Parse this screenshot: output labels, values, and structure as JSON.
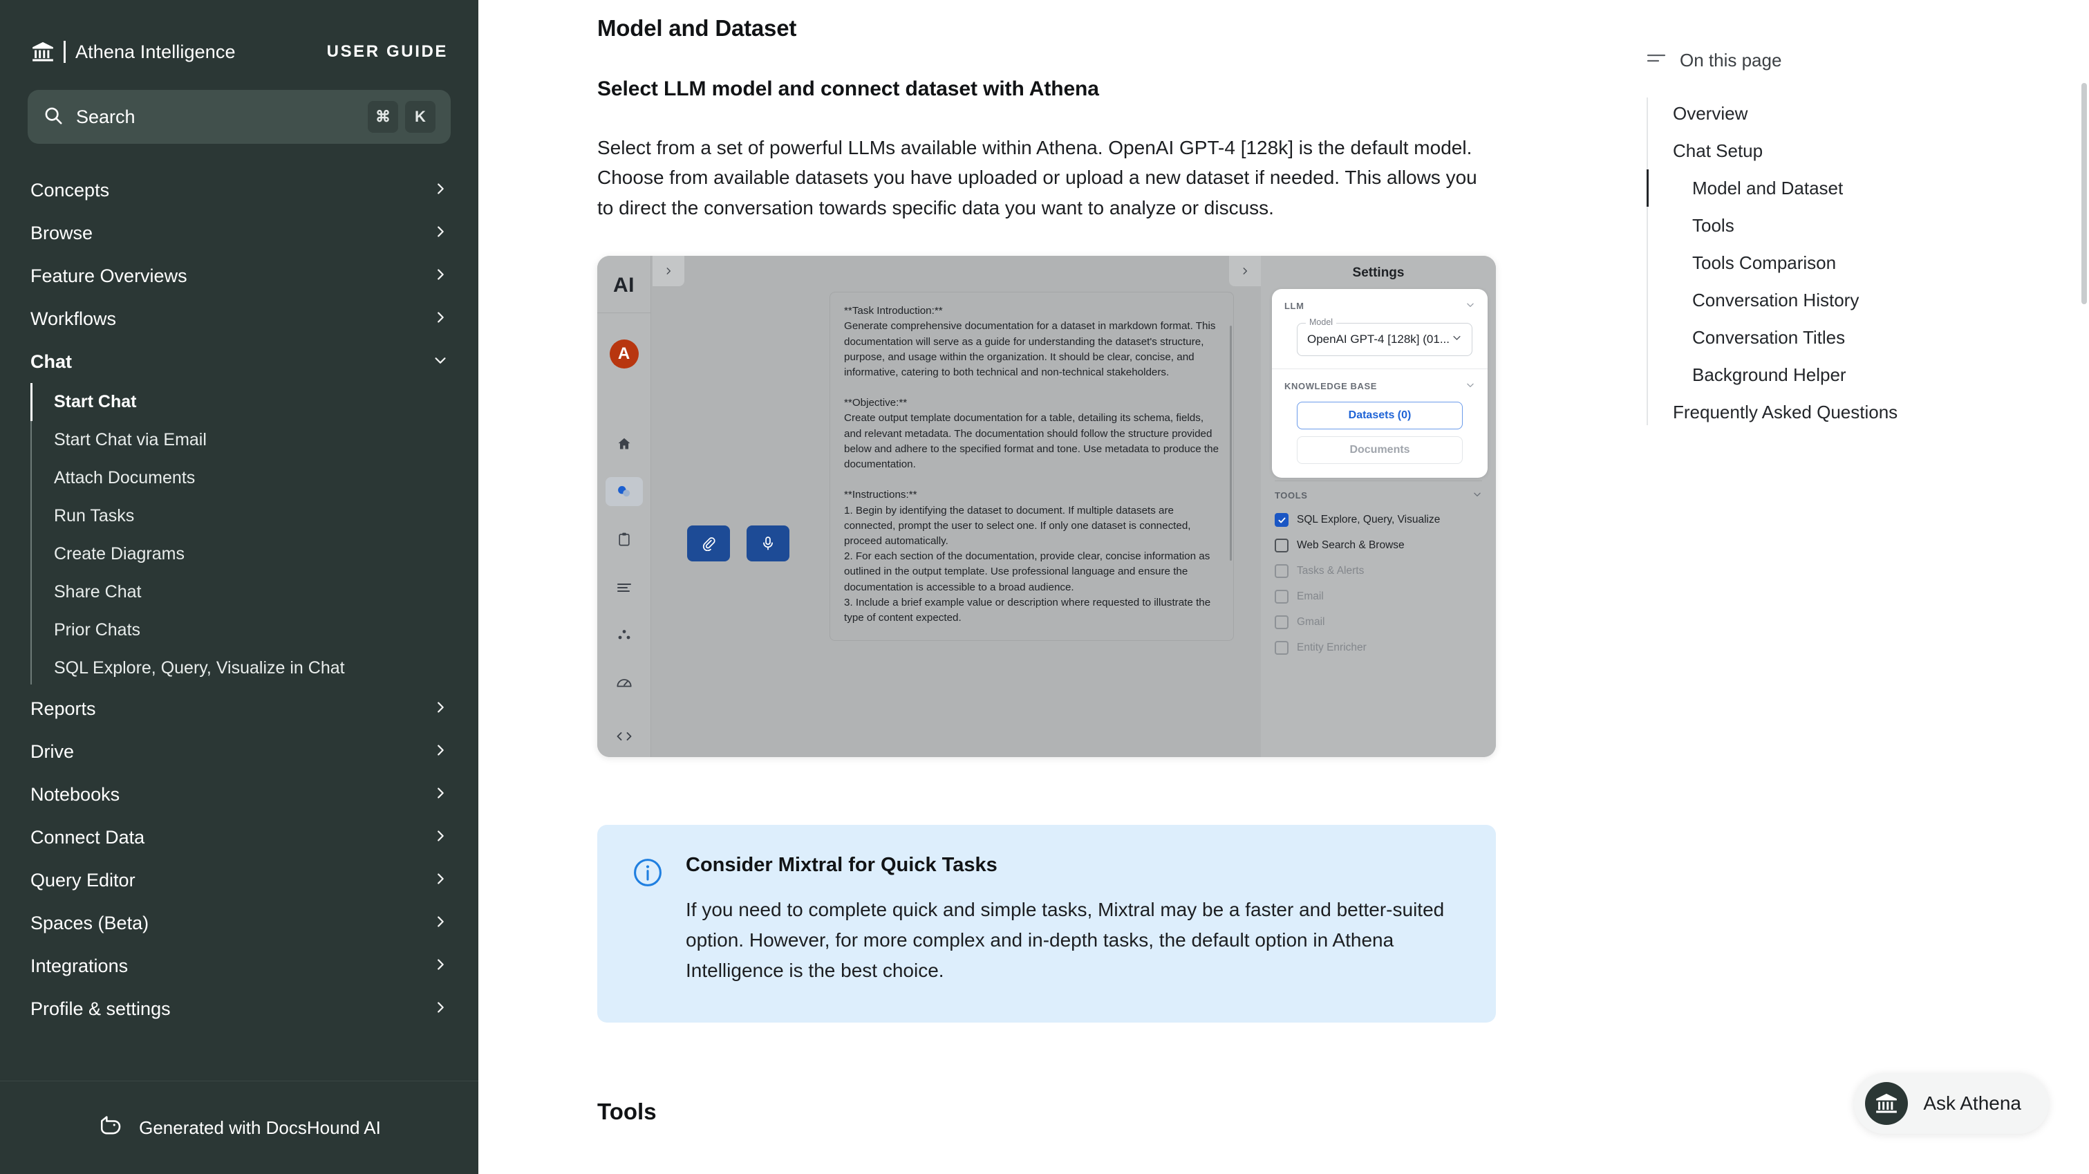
{
  "sidebar": {
    "brand_name": "Athena Intelligence",
    "brand_icon": "bank-columns-icon",
    "user_guide_label": "USER GUIDE",
    "search": {
      "placeholder": "Search",
      "icon": "search-icon",
      "kbd_modifier": "⌘",
      "kbd_key": "K"
    },
    "items": [
      {
        "label": "Concepts",
        "expanded": false
      },
      {
        "label": "Browse",
        "expanded": false
      },
      {
        "label": "Feature Overviews",
        "expanded": false
      },
      {
        "label": "Workflows",
        "expanded": false
      },
      {
        "label": "Chat",
        "expanded": true
      },
      {
        "label": "Reports",
        "expanded": false
      },
      {
        "label": "Drive",
        "expanded": false
      },
      {
        "label": "Notebooks",
        "expanded": false
      },
      {
        "label": "Connect Data",
        "expanded": false
      },
      {
        "label": "Query Editor",
        "expanded": false
      },
      {
        "label": "Spaces (Beta)",
        "expanded": false
      },
      {
        "label": "Integrations",
        "expanded": false
      },
      {
        "label": "Profile & settings",
        "expanded": false
      }
    ],
    "chat_children": [
      {
        "label": "Start Chat",
        "active": true
      },
      {
        "label": "Start Chat via Email",
        "active": false
      },
      {
        "label": "Attach Documents",
        "active": false
      },
      {
        "label": "Run Tasks",
        "active": false
      },
      {
        "label": "Create Diagrams",
        "active": false
      },
      {
        "label": "Share Chat",
        "active": false
      },
      {
        "label": "Prior Chats",
        "active": false
      },
      {
        "label": "SQL Explore, Query, Visualize in Chat",
        "active": false
      }
    ],
    "footer": {
      "label": "Generated with DocsHound AI",
      "icon": "dog-head-icon"
    }
  },
  "article": {
    "heading": "Model and Dataset",
    "subheading": "Select LLM model and connect dataset with Athena",
    "paragraph": "Select from a set of powerful LLMs available within Athena. OpenAI GPT-4 [128k] is the default model. Choose from available datasets you have uploaded or upload a new dataset if needed. This allows you to direct the conversation towards specific data you want to analyze or discuss.",
    "bottom_heading": "Tools"
  },
  "screenshot": {
    "rail": {
      "logo": "AI",
      "avatar_initial": "A",
      "avatar_color": "#b8360f",
      "icons": [
        "home-icon",
        "chat-bubbles-icon",
        "clipboard-icon",
        "list-lines-icon",
        "dots-cluster-icon",
        "gauge-icon"
      ],
      "bottom_icon": "code-brackets-icon"
    },
    "message": "**Task Introduction:**\nGenerate comprehensive documentation for a dataset in markdown format. This documentation will serve as a guide for understanding the dataset's structure, purpose, and usage within the organization. It should be clear, concise, and informative, catering to both technical and non-technical stakeholders.\n\n**Objective:**\nCreate output template documentation for a table, detailing its schema, fields, and relevant metadata. The documentation should follow the structure provided below and adhere to the specified format and tone. Use metadata to produce the documentation.\n\n**Instructions:**\n1. Begin by identifying the dataset to document. If multiple datasets are connected, prompt the user to select one. If only one dataset is connected, proceed automatically.\n2. For each section of the documentation, provide clear, concise information as outlined in the output template. Use professional language and ensure the documentation is accessible to a broad audience.\n3. Include a brief example value or description where requested to illustrate the type of content expected.\n\n**Output Template:**",
    "compose_buttons": [
      {
        "name": "attach-button",
        "icon": "paperclip-icon"
      },
      {
        "name": "mic-button",
        "icon": "microphone-icon"
      },
      {
        "name": "send-button",
        "icon": "send-paper-plane-icon"
      }
    ],
    "settings": {
      "title": "Settings",
      "llm_section_label": "LLM",
      "model_field_legend": "Model",
      "model_value": "OpenAI GPT-4 [128k] (01...",
      "knowledge_base_label": "KNOWLEDGE BASE",
      "datasets_button": "Datasets (0)",
      "documents_button": "Documents",
      "tools_label": "TOOLS",
      "tools": [
        {
          "label": "SQL Explore, Query, Visualize",
          "checked": true,
          "disabled": false
        },
        {
          "label": "Web Search & Browse",
          "checked": false,
          "disabled": false
        },
        {
          "label": "Tasks & Alerts",
          "checked": false,
          "disabled": true
        },
        {
          "label": "Email",
          "checked": false,
          "disabled": true
        },
        {
          "label": "Gmail",
          "checked": false,
          "disabled": true
        },
        {
          "label": "Entity Enricher",
          "checked": false,
          "disabled": true
        }
      ]
    }
  },
  "callout": {
    "icon": "info-circle-icon",
    "title": "Consider Mixtral for Quick Tasks",
    "body": "If you need to complete quick and simple tasks, Mixtral may be a faster and better-suited option. However, for more complex and in-depth tasks, the default option in Athena Intelligence is the best choice."
  },
  "toc": {
    "icon": "list-lines-icon",
    "label": "On this page",
    "items": [
      {
        "label": "Overview",
        "level": 1,
        "active": false
      },
      {
        "label": "Chat Setup",
        "level": 1,
        "active": false
      },
      {
        "label": "Model and Dataset",
        "level": 2,
        "active": true
      },
      {
        "label": "Tools",
        "level": 2,
        "active": false
      },
      {
        "label": "Tools Comparison",
        "level": 2,
        "active": false
      },
      {
        "label": "Conversation History",
        "level": 2,
        "active": false
      },
      {
        "label": "Conversation Titles",
        "level": 2,
        "active": false
      },
      {
        "label": "Background Helper",
        "level": 2,
        "active": false
      },
      {
        "label": "Frequently Asked Questions",
        "level": 1,
        "active": false
      }
    ]
  },
  "ask_athena": {
    "label": "Ask Athena",
    "icon": "bank-columns-icon"
  },
  "colors": {
    "sidebar_bg": "#2b3735",
    "search_bg": "#41504c",
    "accent_blue": "#1d4b96",
    "callout_bg": "#ddeefc",
    "checkbox_checked": "#1a56c4",
    "avatar": "#b8360f"
  }
}
